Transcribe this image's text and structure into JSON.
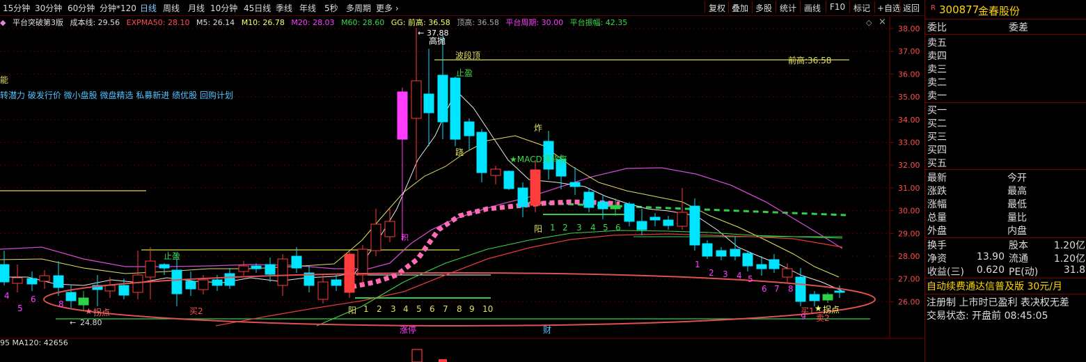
{
  "toolbar": {
    "timeframes": [
      "15分钟",
      "30分钟",
      "60分钟",
      "分钟*120",
      "日线",
      "周线",
      "月线",
      "10分钟",
      "45日线",
      "季线",
      "年线",
      "5秒",
      "多周期",
      "更多"
    ],
    "active_timeframe": "日线",
    "more_chevron": "›",
    "buttons": [
      "复权",
      "叠加",
      "多股",
      "统计",
      "画线",
      "F10",
      "标记",
      "+自选",
      "返回"
    ]
  },
  "indicator_line": {
    "name": "平台突破第3版",
    "cost_line": "成本线: 29.56",
    "expma50": "EXPMA50: 28.10",
    "m5": "M5: 26.14",
    "m10": "M10: 26.78",
    "m20": "M20: 28.03",
    "m60": "M60: 28.60",
    "gg": "GG: 前高: 36.58",
    "top_high": "顶高: 36.58",
    "platform_period": "平台周期: 30.00",
    "platform_amp": "平台振幅: 42.35"
  },
  "left_text": {
    "neng": "能",
    "tags": "转潜力 破发行价 微小盘股 微盘精选 私募新进 绩优股 回购计划"
  },
  "price_axis": [
    "38.00",
    "37.00",
    "36.00",
    "35.00",
    "34.00",
    "33.00",
    "32.00",
    "31.00",
    "30.00",
    "29.00",
    "28.00",
    "27.00",
    "26.00"
  ],
  "annotations": {
    "high_price": "37.88",
    "gao_pao": "高抛",
    "bo_duan_ding": "波段顶",
    "qian_gao": "前高:36.58",
    "zhi_ying_top": "止盈",
    "zhi_ying_left": "止盈",
    "zha": "炸",
    "macd": "★MACD顶背离",
    "yin_label": "阳",
    "sequence_1": [
      "1",
      "2",
      "3",
      "4",
      "5",
      "6"
    ],
    "sequence_2": [
      "阳",
      "1",
      "2",
      "3",
      "4",
      "5",
      "6",
      "7",
      "8",
      "9",
      "10"
    ],
    "sequence_3": [
      "1",
      "2",
      "3",
      "4",
      "5",
      "6",
      "7",
      "8",
      "9"
    ],
    "sequence_left": [
      "4",
      "5",
      "6",
      "8"
    ],
    "low_price": "24.80",
    "guai_dian_left": "拐点",
    "guai_dian_right": "拐点",
    "mai2_left": "买2",
    "mai1_right": "买1",
    "mai2_right": "卖2",
    "zhang_ting": "涨停",
    "cai": "财",
    "ji": "积",
    "jiao": "跷"
  },
  "bottom_line": {
    "left": "95",
    "ma120": "MA120: 42656"
  },
  "panel": {
    "code": "300877",
    "name": "金春股份",
    "wei_bi": "委比",
    "wei_cha": "委差",
    "sells": [
      "卖五",
      "卖四",
      "卖三",
      "卖二",
      "卖一"
    ],
    "buys": [
      "买一",
      "买二",
      "买三",
      "买四",
      "买五"
    ],
    "stats_left": [
      "最新",
      "涨跌",
      "涨幅",
      "总量",
      "外盘"
    ],
    "stats_right": [
      "今开",
      "最高",
      "最低",
      "量比",
      "内盘"
    ],
    "fin": [
      {
        "l": "换手",
        "m": "",
        "rl": "股本",
        "rv": "1.20亿"
      },
      {
        "l": "净资",
        "m": "13.90",
        "rl": "流通",
        "rv": "1.20亿"
      },
      {
        "l": "收益(三)",
        "m": "0.620",
        "rl": "PE(动)",
        "rv": "31.8"
      }
    ],
    "promo": "自动续费通达信普及版",
    "promo_price": "30元/月",
    "notice": "注册制 上市时已盈利 表决权无差",
    "status_label": "交易状态:",
    "status_value": "开盘前 08:45:05"
  },
  "colors": {
    "up": "#ff3c3c",
    "down": "#00e5ff",
    "magenta": "#ff3cff",
    "yellow": "#ffff66",
    "green": "#2fd14a",
    "grid": "#7a0000",
    "accent": "#ff5555"
  }
}
